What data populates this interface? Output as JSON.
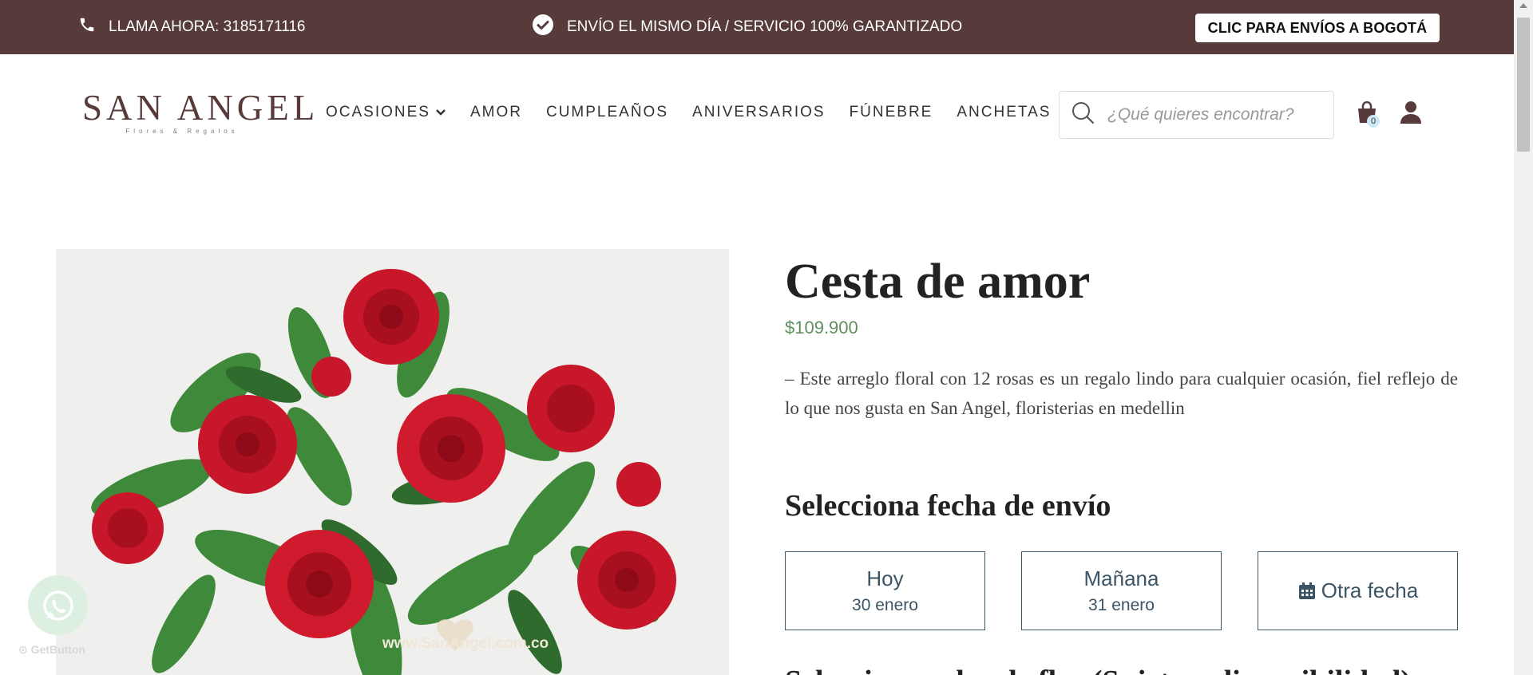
{
  "topbar": {
    "call_label": "LLAMA AHORA: 3185171116",
    "shipping_label": "ENVÍO EL MISMO DÍA / SERVICIO 100% GARANTIZADO",
    "bogota_button": "CLIC PARA ENVÍOS A BOGOTÁ",
    "bg_color": "#573b3b"
  },
  "header": {
    "logo_brand": "SAN ANGEL",
    "logo_tagline": "Flores & Regalos",
    "nav": [
      "OCASIONES",
      "AMOR",
      "CUMPLEAÑOS",
      "ANIVERSARIOS",
      "FÚNEBRE",
      "ANCHETAS"
    ],
    "search_placeholder": "¿Qué quieres encontrar?",
    "cart_count": "0"
  },
  "product": {
    "title": "Cesta de amor",
    "price": "$109.900",
    "description": "– Este arreglo floral con 12 rosas es un regalo lindo para cualquier ocasión, fiel reflejo de lo que nos gusta en San Angel, floristerias en medellin",
    "image_watermark": "www.SanAngel.com.co"
  },
  "delivery": {
    "title": "Selecciona fecha de envío",
    "options": [
      {
        "label": "Hoy",
        "date": "30 enero"
      },
      {
        "label": "Mañana",
        "date": "31 enero"
      },
      {
        "label": "Otra fecha",
        "date": ""
      }
    ]
  },
  "next_section_title": "Selecciona color de flor (Sujeto a disponibilidad)",
  "widget": {
    "getbutton_label": "GetButton"
  },
  "colors": {
    "price": "#5f8f5f",
    "option_border": "#3c5a66"
  }
}
